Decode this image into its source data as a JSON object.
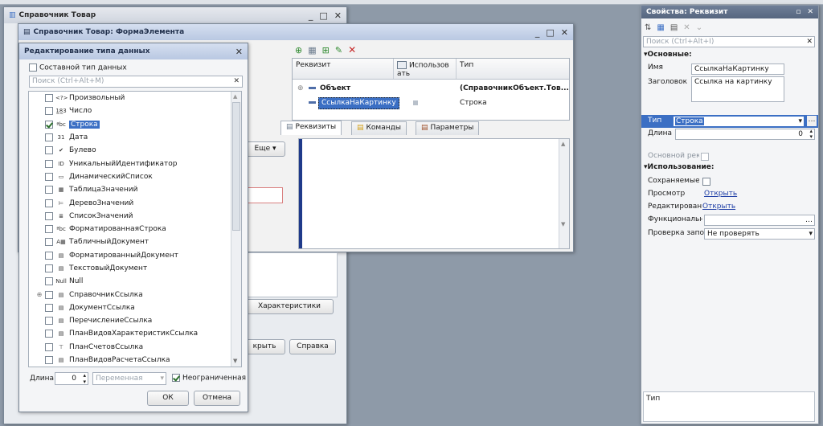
{
  "main_window": {
    "title": "Справочник Товар"
  },
  "form_window": {
    "title": "Справочник Товар: ФормаЭлемента",
    "columns": [
      "Реквизит",
      "Использов ать",
      "Тип"
    ],
    "rows": [
      {
        "name": "Объект",
        "type": "(СправочникОбъект.Тов..."
      },
      {
        "name": "СсылкаНаКартинку",
        "type": "Строка"
      }
    ],
    "tabs": [
      "Реквизиты",
      "Команды",
      "Параметры"
    ],
    "more_button": "Еще",
    "characteristics_button": "Характеристики",
    "open_button_partial": "крыть",
    "help_button": "Справка"
  },
  "type_dialog": {
    "title": "Редактирование типа данных",
    "composite_label": "Составной тип данных",
    "search_placeholder": "Поиск (Ctrl+Alt+M)",
    "types": [
      {
        "label": "Произвольный",
        "icon": "<?>",
        "checked": false
      },
      {
        "label": "Число",
        "icon": "1̲8̲3",
        "checked": false
      },
      {
        "label": "Строка",
        "icon": "ªbc",
        "checked": true,
        "selected": true
      },
      {
        "label": "Дата",
        "icon": "31",
        "checked": false
      },
      {
        "label": "Булево",
        "icon": "✔",
        "checked": false
      },
      {
        "label": "УникальныйИдентификатор",
        "icon": "ID",
        "checked": false
      },
      {
        "label": "ДинамическийСписок",
        "icon": "▭",
        "checked": false
      },
      {
        "label": "ТаблицаЗначений",
        "icon": "▦",
        "checked": false
      },
      {
        "label": "ДеревоЗначений",
        "icon": "⊨",
        "checked": false
      },
      {
        "label": "СписокЗначений",
        "icon": "≣",
        "checked": false
      },
      {
        "label": "ФорматированнаяСтрока",
        "icon": "ªbc",
        "checked": false
      },
      {
        "label": "ТабличныйДокумент",
        "icon": "A▦",
        "checked": false
      },
      {
        "label": "ФорматированныйДокумент",
        "icon": "▤",
        "checked": false
      },
      {
        "label": "ТекстовыйДокумент",
        "icon": "▤",
        "checked": false
      },
      {
        "label": "Null",
        "icon": "Null",
        "checked": false
      },
      {
        "label": "СправочникСсылка",
        "icon": "▤",
        "checked": false,
        "expandable": true
      },
      {
        "label": "ДокументСсылка",
        "icon": "▤",
        "checked": false
      },
      {
        "label": "ПеречислениеСсылка",
        "icon": "▤",
        "checked": false
      },
      {
        "label": "ПланВидовХарактеристикСсылка",
        "icon": "▤",
        "checked": false
      },
      {
        "label": "ПланСчетовСсылка",
        "icon": "⊤",
        "checked": false
      },
      {
        "label": "ПланВидовРасчетаСсылка",
        "icon": "▤",
        "checked": false
      }
    ],
    "length_label": "Длина",
    "length_value": "0",
    "variable_label": "Переменная",
    "unlimited_label": "Неограниченная",
    "ok_label": "ОК",
    "cancel_label": "Отмена"
  },
  "props_panel": {
    "title": "Свойства: Реквизит",
    "search_placeholder": "Поиск (Ctrl+Alt+I)",
    "basic_section": "Основные:",
    "name_label": "Имя",
    "name_value": "СсылкаНаКартинку",
    "header_label": "Заголовок",
    "header_value": "Ссылка на картинку",
    "type_label": "Тип",
    "type_value": "Строка",
    "length_label": "Длина",
    "length_value": "0",
    "main_req_label": "Основной рекв",
    "usage_section": "Использование:",
    "saved_label": "Сохраняемые д",
    "view_label": "Просмотр",
    "view_value": "Открыть",
    "edit_label": "Редактировани",
    "edit_value": "Открыть",
    "func_label": "Функциональн",
    "check_label": "Проверка запо",
    "check_value": "Не проверять",
    "desc_text": "Тип"
  },
  "colors": {
    "accent": "#3b6fc4",
    "panel_title": "#56667f"
  }
}
